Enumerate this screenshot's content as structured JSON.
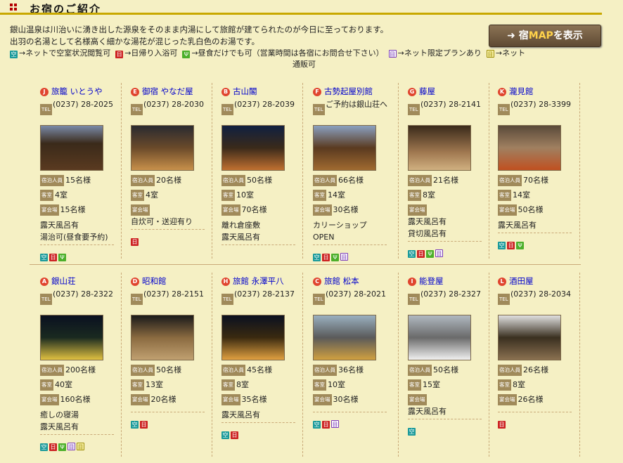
{
  "header": {
    "title": "お宿のご紹介"
  },
  "intro": [
    "銀山温泉は川治いに湧き出した源泉をそのまま内湯にして旅館が建てられたのが今日に至っております。",
    "出羽の名湯として名様高く細かな湯花が混じった乳白色のお湯です。"
  ],
  "legend": {
    "kuu_icon": "空",
    "kuu_text": "→ネットで空室状況閲覧可",
    "hi_icon": "日",
    "hi_text": "→日帰り入浴可",
    "lunch_icon": "Ψ",
    "lunch_text": "→昼食だけでも可（営業時間は各宿にお問合せ下さい）",
    "plan_icon": "目",
    "plan_text": "→ネット限定プランあり",
    "shop_icon": "目",
    "shop_text": "→ネット",
    "shop_text2": "通販可"
  },
  "map_button": {
    "arrow": "➜",
    "label_pre": "宿",
    "label_map": "MAP",
    "label_post": "を表示"
  },
  "labels": {
    "tel": "TEL",
    "guests": "宿泊人員",
    "rooms": "客室",
    "banquet": "宴会場"
  },
  "colors": {
    "background": "#f5f0c4",
    "accent_line": "#c8a800",
    "link": "#0000cc",
    "badge": "#e0452f"
  },
  "inns": [
    {
      "letter": "J",
      "name": "旅籠 いとうや",
      "tel": "(0237) 28-2025",
      "guests": "15名様",
      "rooms": "4室",
      "banquet": "15名様",
      "notes": [
        "露天風呂有",
        "湯治可(昼食要予約)"
      ],
      "icons": [
        "kuu",
        "hi",
        "lunch"
      ]
    },
    {
      "letter": "E",
      "name": "御宿 やなだ屋",
      "tel": "(0237) 28-2030",
      "guests": "20名様",
      "rooms": "4室",
      "banquet": "",
      "notes": [
        "自炊可・送迎有り"
      ],
      "icons": [
        "hi"
      ]
    },
    {
      "letter": "B",
      "name": "古山閣",
      "tel": "(0237) 28-2039",
      "guests": "50名様",
      "rooms": "10室",
      "banquet": "70名様",
      "notes": [
        "離れ倉座敷",
        "露天風呂有"
      ],
      "icons": []
    },
    {
      "letter": "F",
      "name": "古勢起屋別館",
      "tel": "ご予約は銀山荘へ",
      "guests": "66名様",
      "rooms": "14室",
      "banquet": "30名様",
      "notes": [
        "カリーショップ",
        "OPEN"
      ],
      "icons": [
        "kuu",
        "hi",
        "lunch",
        "plan"
      ]
    },
    {
      "letter": "G",
      "name": "藤屋",
      "tel": "(0237) 28-2141",
      "guests": "21名様",
      "rooms": "8室",
      "banquet": "",
      "notes": [
        "露天風呂有",
        "貸切風呂有"
      ],
      "icons": [
        "kuu",
        "hi",
        "lunch",
        "plan"
      ]
    },
    {
      "letter": "K",
      "name": "瀧見館",
      "tel": "(0237) 28-3399",
      "guests": "70名様",
      "rooms": "14室",
      "banquet": "50名様",
      "notes": [
        "露天風呂有"
      ],
      "icons": [
        "kuu",
        "hi",
        "lunch"
      ]
    },
    {
      "letter": "A",
      "name": "銀山荘",
      "tel": "(0237) 28-2322",
      "guests": "200名様",
      "rooms": "40室",
      "banquet": "160名様",
      "notes": [
        "癒しの寝湯",
        "露天風呂有"
      ],
      "icons": [
        "kuu",
        "hi",
        "lunch",
        "plan",
        "shop"
      ]
    },
    {
      "letter": "D",
      "name": "昭和館",
      "tel": "(0237) 28-2151",
      "guests": "50名様",
      "rooms": "13室",
      "banquet": "20名様",
      "notes": [],
      "icons": [
        "kuu",
        "hi"
      ]
    },
    {
      "letter": "H",
      "name": "旅館 永澤平八",
      "tel": "(0237) 28-2137",
      "guests": "45名様",
      "rooms": "8室",
      "banquet": "35名様",
      "notes": [
        "露天風呂有"
      ],
      "icons": [
        "kuu",
        "hi"
      ]
    },
    {
      "letter": "C",
      "name": "旅館 松本",
      "tel": "(0237) 28-2021",
      "guests": "36名様",
      "rooms": "10室",
      "banquet": "30名様",
      "notes": [],
      "icons": [
        "kuu",
        "hi",
        "plan"
      ]
    },
    {
      "letter": "I",
      "name": "能登屋",
      "tel": "(0237) 28-2327",
      "guests": "50名様",
      "rooms": "15室",
      "banquet": "",
      "notes": [
        "露天風呂有"
      ],
      "icons": [
        "kuu"
      ]
    },
    {
      "letter": "L",
      "name": "酒田屋",
      "tel": "(0237) 28-2034",
      "guests": "26名様",
      "rooms": "8室",
      "banquet": "26名様",
      "notes": [],
      "icons": [
        "hi"
      ]
    }
  ]
}
